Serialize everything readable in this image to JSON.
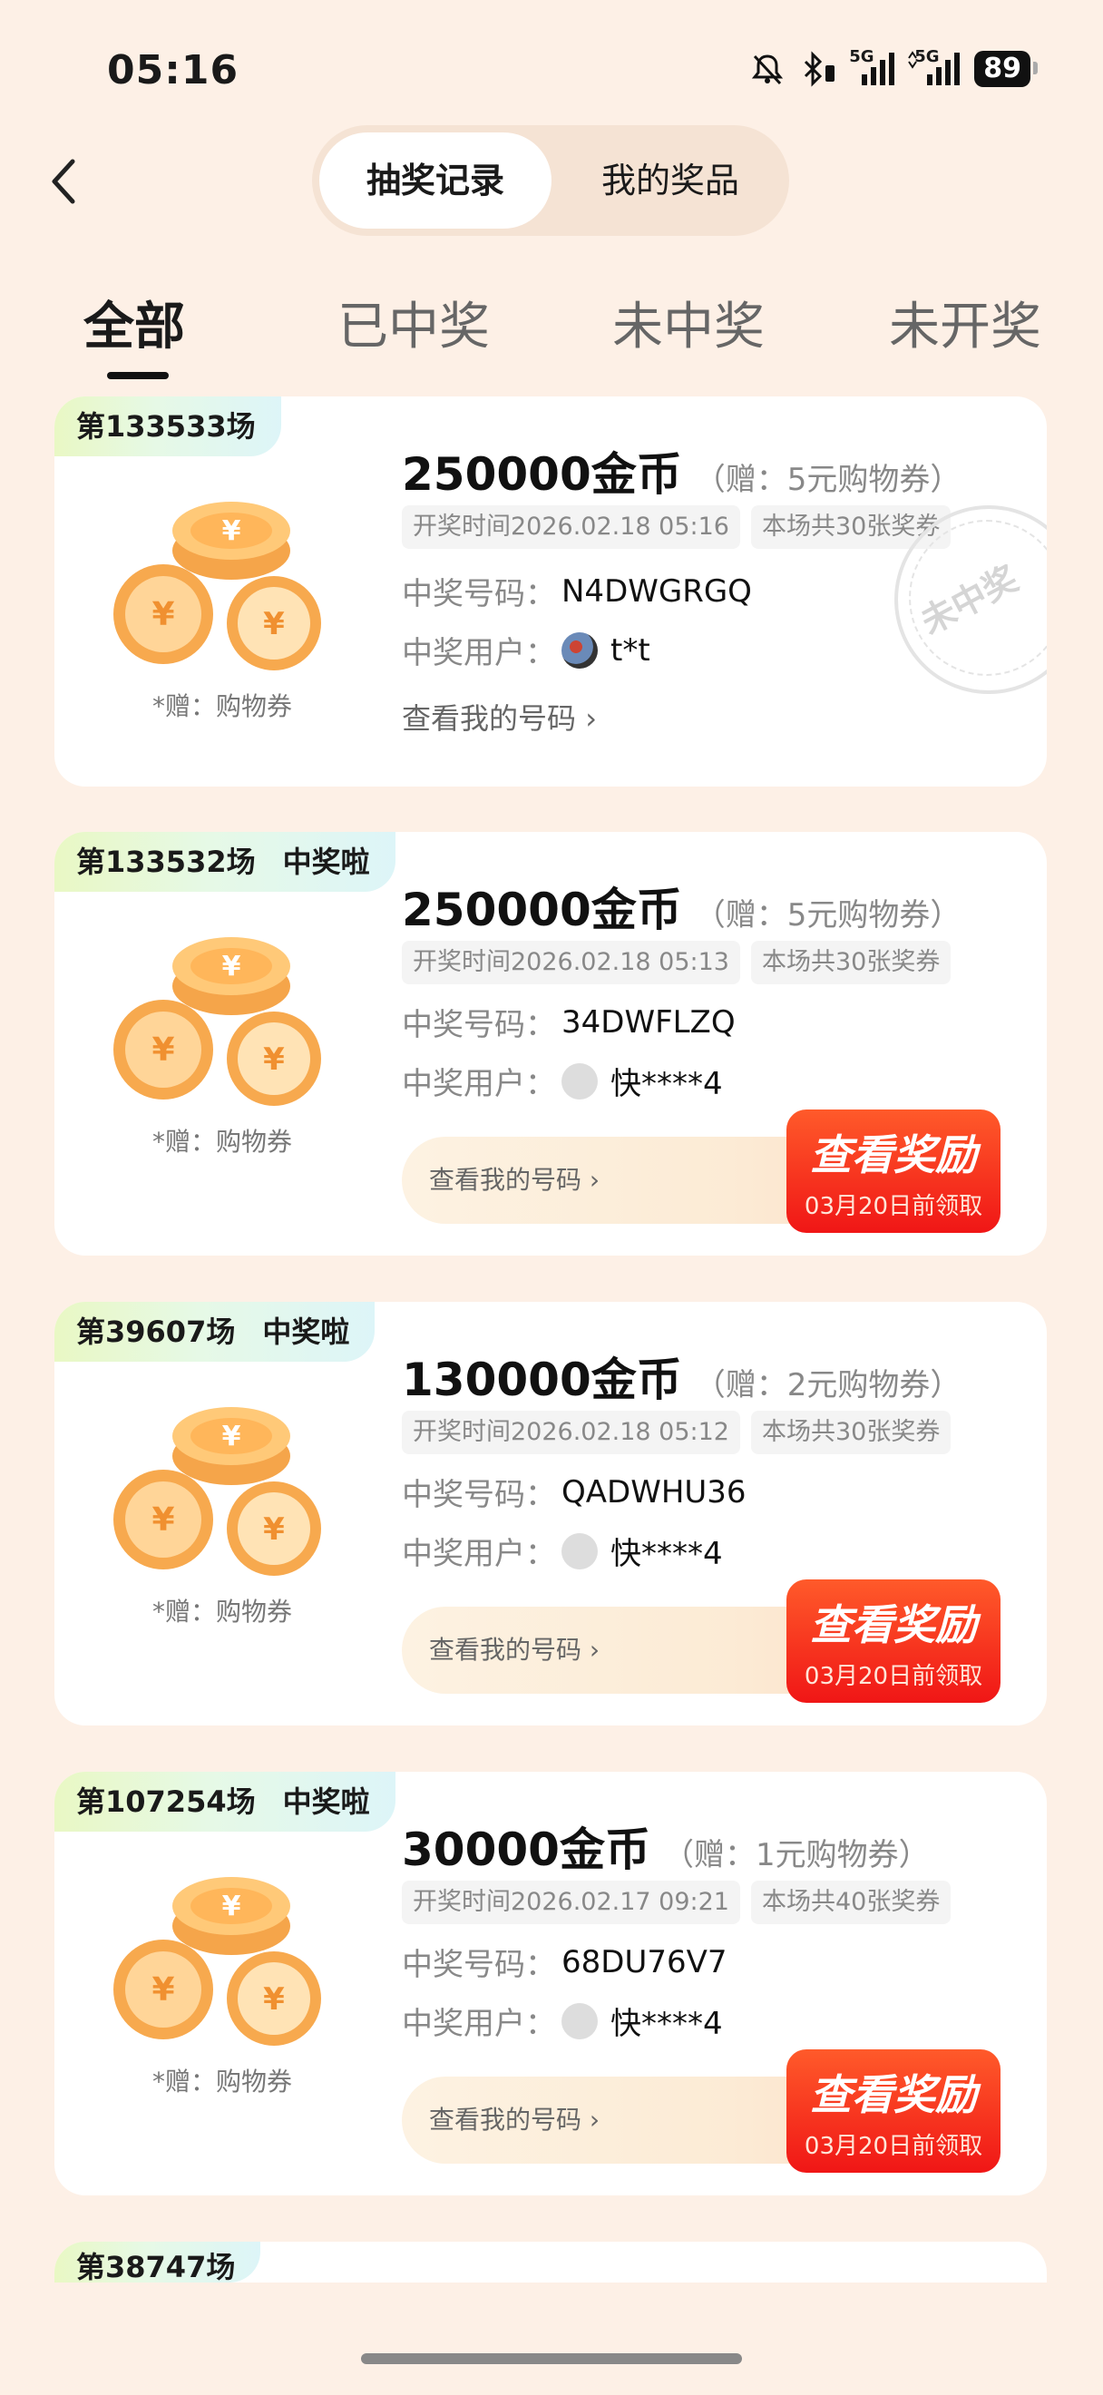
{
  "status": {
    "time": "05:16",
    "net1": "5G",
    "net2": "5G",
    "battery": "89"
  },
  "header": {
    "segments": [
      "抽奖记录",
      "我的奖品"
    ],
    "active_segment": 0
  },
  "tabs": [
    "全部",
    "已中奖",
    "未中奖",
    "未开奖"
  ],
  "labels": {
    "draw_time_prefix": "开奖时间",
    "win_number": "中奖号码：",
    "win_user": "中奖用户：",
    "view_my_number": "查看我的号码",
    "gift_note": "*赠：购物券",
    "won": "中奖啦",
    "not_won_stamp": "未中奖",
    "view_reward": "查看奖励",
    "claim_deadline": "03月20日前领取"
  },
  "records": [
    {
      "session": "第133533场",
      "won": false,
      "prize": "250000金币",
      "bonus": "（赠：5元购物券）",
      "draw_time": "开奖时间2026.02.18 05:16",
      "tickets": "本场共30张奖券",
      "number": "N4DWGRGQ",
      "user": "t*t"
    },
    {
      "session": "第133532场",
      "won": true,
      "prize": "250000金币",
      "bonus": "（赠：5元购物券）",
      "draw_time": "开奖时间2026.02.18 05:13",
      "tickets": "本场共30张奖券",
      "number": "34DWFLZQ",
      "user": "快****4"
    },
    {
      "session": "第39607场",
      "won": true,
      "prize": "130000金币",
      "bonus": "（赠：2元购物券）",
      "draw_time": "开奖时间2026.02.18 05:12",
      "tickets": "本场共30张奖券",
      "number": "QADWHU36",
      "user": "快****4"
    },
    {
      "session": "第107254场",
      "won": true,
      "prize": "30000金币",
      "bonus": "（赠：1元购物券）",
      "draw_time": "开奖时间2026.02.17 09:21",
      "tickets": "本场共40张奖券",
      "number": "68DU76V7",
      "user": "快****4"
    },
    {
      "session": "第38747场"
    }
  ],
  "colors": {
    "background": "#FDF0E6",
    "reward_red": "#F01616",
    "tag_green": "#E9F8C4"
  }
}
